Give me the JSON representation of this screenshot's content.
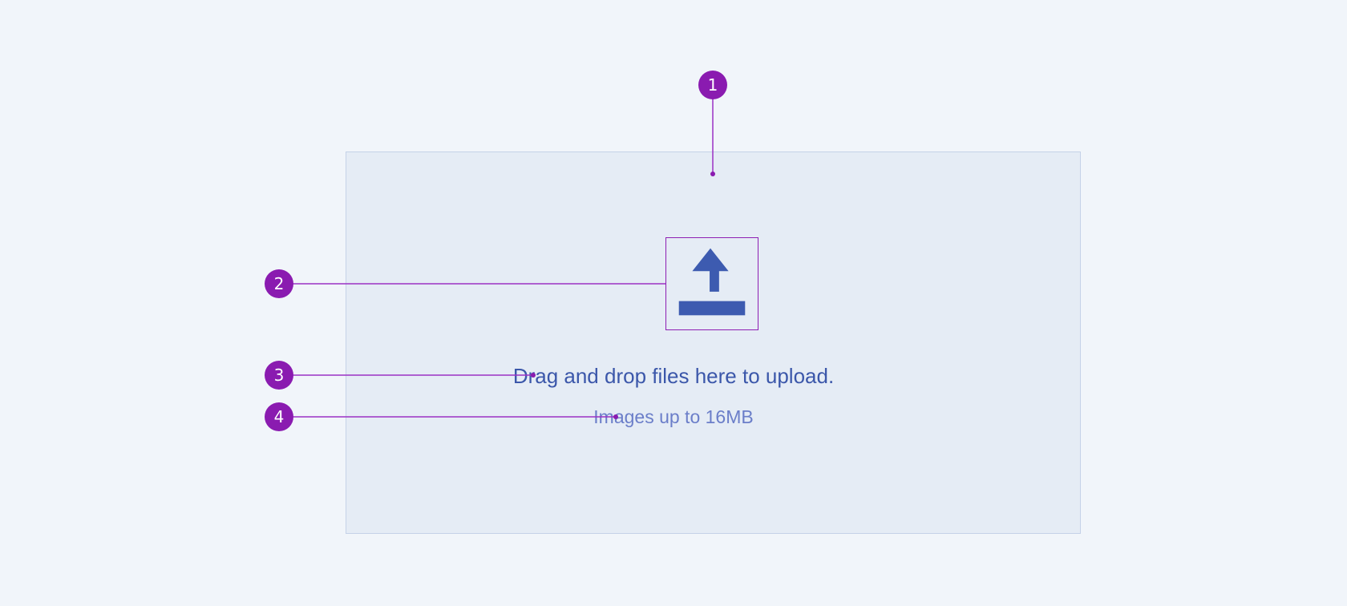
{
  "dropzone": {
    "title": "Drag and drop files here to upload.",
    "hint": "Images up to 16MB",
    "icon": "upload-icon"
  },
  "callouts": {
    "markers": [
      "1",
      "2",
      "3",
      "4"
    ]
  },
  "colors": {
    "background": "#f1f5fa",
    "dropzone_fill": "#e5ecf5",
    "dropzone_border": "#c5d2e8",
    "accent": "#3b57aa",
    "hint_text": "#6b7ec9",
    "callout": "#8a1bb0"
  }
}
